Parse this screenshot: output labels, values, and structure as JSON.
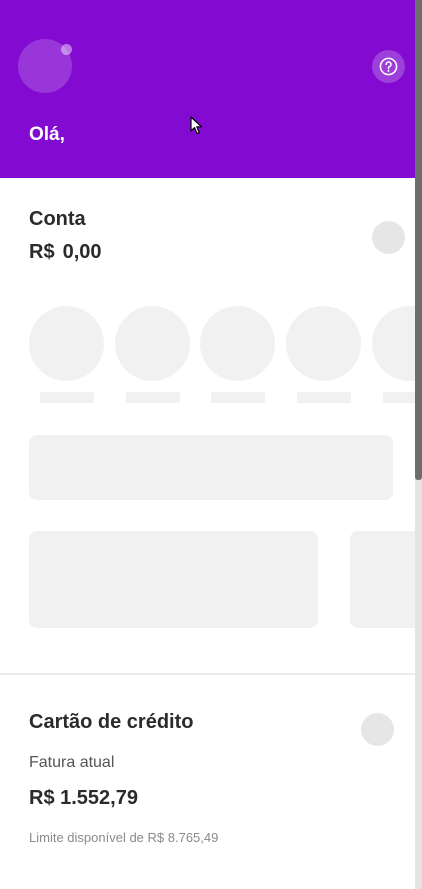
{
  "header": {
    "greeting": "Olá,",
    "help_icon": "help-circle-icon",
    "background_color": "#820ad1"
  },
  "account": {
    "title": "Conta",
    "currency": "R$",
    "balance": "0,00"
  },
  "credit_card": {
    "title": "Cartão de crédito",
    "invoice_label": "Fatura atual",
    "invoice_value": "R$ 1.552,79",
    "limit_text": "Limite disponível de R$ 8.765,49"
  }
}
